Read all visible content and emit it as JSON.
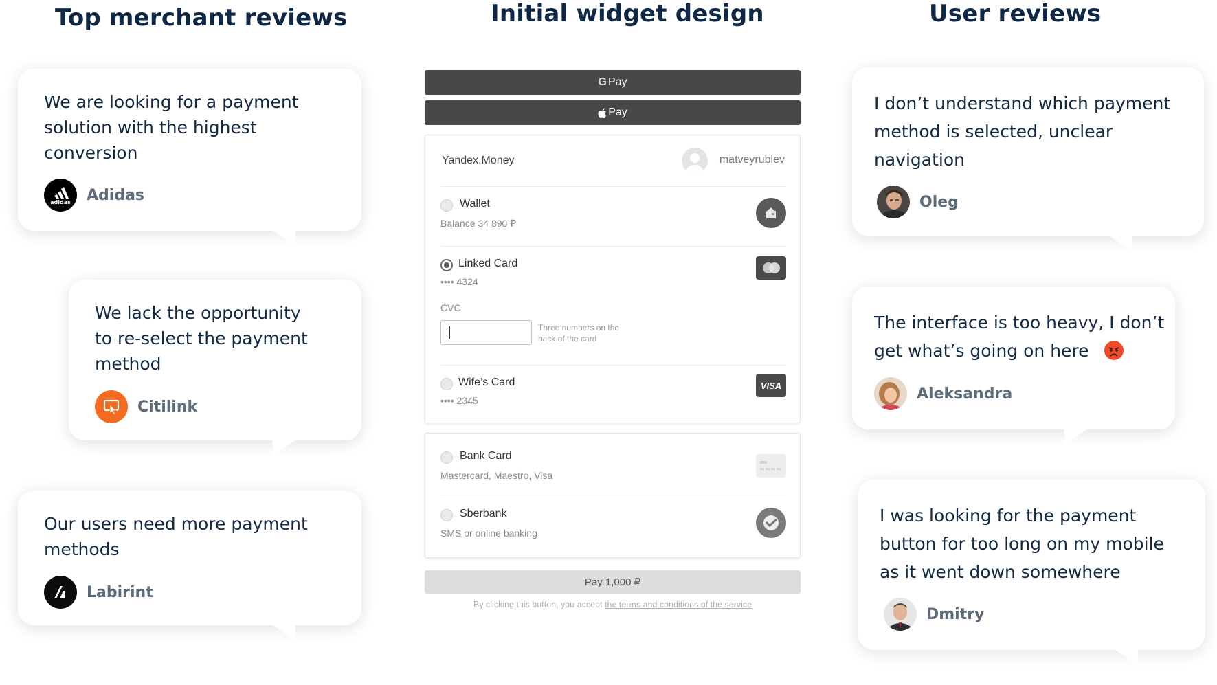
{
  "columns": {
    "merchant_title": "Top merchant reviews",
    "widget_title": "Initial widget design",
    "user_title": "User reviews"
  },
  "merchant_reviews": [
    {
      "quote_lines": [
        "We are looking for a payment",
        "solution with the highest",
        "conversion"
      ],
      "author": "Adidas",
      "logo_icon": "adidas-logo-icon",
      "logo_text": "adidas"
    },
    {
      "quote_lines": [
        "We lack the opportunity",
        "to re-select the payment",
        "method"
      ],
      "author": "Citilink",
      "logo_icon": "citilink-logo-icon"
    },
    {
      "quote_lines": [
        "Our users need more payment",
        "methods"
      ],
      "author": "Labirint",
      "logo_icon": "labirint-logo-icon"
    }
  ],
  "user_reviews": [
    {
      "quote_lines": [
        "I don’t understand which payment",
        "method is selected, unclear",
        "navigation"
      ],
      "author": "Oleg"
    },
    {
      "quote_lines": [
        "The interface is too heavy, I don’t",
        "get what’s going on here"
      ],
      "author": "Aleksandra",
      "emoji": "😡"
    },
    {
      "quote_lines": [
        "I was looking for the payment",
        "button for too long on my mobile",
        "as it went down somewhere"
      ],
      "author": "Dmitry"
    }
  ],
  "widget": {
    "gpay_label": "Pay",
    "gpay_g": "G",
    "applepay_label": "Pay",
    "provider": "Yandex.Money",
    "username": "matveyrublev",
    "methods": [
      {
        "title": "Wallet",
        "sub": "Balance 34 890 ₽",
        "selected": false,
        "icon": "wallet-icon"
      },
      {
        "title": "Linked Card",
        "sub": "•••• 4324",
        "selected": true,
        "icon": "mastercard-icon"
      },
      {
        "title": "Wife’s Card",
        "sub": "•••• 2345",
        "selected": false,
        "icon": "visa-icon",
        "icon_text": "VISA"
      },
      {
        "title": "Bank Card",
        "sub": "Mastercard, Maestro, Visa",
        "selected": false,
        "icon": "bank-card-icon"
      },
      {
        "title": "Sberbank",
        "sub": "SMS or online banking",
        "selected": false,
        "icon": "sberbank-icon"
      }
    ],
    "cvc_label": "CVC",
    "cvc_hint_lines": [
      "Three numbers on the",
      "back of the card"
    ],
    "pay_button": "Pay 1,000 ₽",
    "terms_prefix": "By clicking this button, you accept ",
    "terms_link": "the terms and conditions of the service"
  },
  "colors": {
    "title": "#0f2846",
    "citilink": "#f36a21",
    "dark_button": "#484848"
  }
}
